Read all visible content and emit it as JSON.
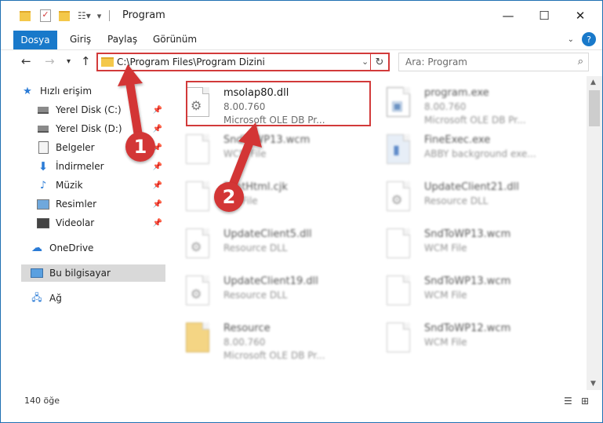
{
  "window": {
    "title": "Program"
  },
  "ribbon": {
    "tabs": [
      "Dosya",
      "Giriş",
      "Paylaş",
      "Görünüm"
    ],
    "help": "?"
  },
  "address": {
    "path": "C:\\Program Files\\Program Dizini"
  },
  "search": {
    "placeholder": "Ara: Program"
  },
  "sidebar": {
    "items": [
      {
        "label": "Hızlı erişim",
        "icon": "star-icon",
        "pinned": false
      },
      {
        "label": "Yerel Disk (C:)",
        "icon": "drive-icon",
        "pinned": true
      },
      {
        "label": "Yerel Disk (D:)",
        "icon": "drive-icon",
        "pinned": true
      },
      {
        "label": "Belgeler",
        "icon": "documents-icon",
        "pinned": true
      },
      {
        "label": "İndirmeler",
        "icon": "download-icon",
        "pinned": true
      },
      {
        "label": "Müzik",
        "icon": "music-icon",
        "pinned": true
      },
      {
        "label": "Resimler",
        "icon": "pictures-icon",
        "pinned": true
      },
      {
        "label": "Videolar",
        "icon": "videos-icon",
        "pinned": true
      },
      {
        "label": "OneDrive",
        "icon": "cloud-icon",
        "pinned": false
      },
      {
        "label": "Bu bilgisayar",
        "icon": "computer-icon",
        "pinned": false,
        "selected": true
      },
      {
        "label": "Ağ",
        "icon": "network-icon",
        "pinned": false
      }
    ]
  },
  "files": [
    {
      "name": "msolap80.dll",
      "line1": "8.00.760",
      "line2": "Microsoft OLE DB Pr...",
      "highlighted": true
    },
    {
      "name": "program.exe",
      "line1": "8.00.760",
      "line2": "Microsoft OLE DB Pr..."
    },
    {
      "name": "SndToWP13.wcm",
      "line1": "WCM File",
      "line2": ""
    },
    {
      "name": "FineExec.exe",
      "line1": "ABBY background exe...",
      "line2": ""
    },
    {
      "name": "FontHtml.cjk",
      "line1": "CJK File",
      "line2": ""
    },
    {
      "name": "UpdateClient21.dll",
      "line1": "Resource DLL",
      "line2": ""
    },
    {
      "name": "UpdateClient5.dll",
      "line1": "Resource DLL",
      "line2": ""
    },
    {
      "name": "SndToWP13.wcm",
      "line1": "WCM File",
      "line2": ""
    },
    {
      "name": "UpdateClient19.dll",
      "line1": "Resource DLL",
      "line2": ""
    },
    {
      "name": "SndToWP13.wcm",
      "line1": "WCM File",
      "line2": ""
    },
    {
      "name": "Resource",
      "line1": "8.00.760",
      "line2": "Microsoft OLE DB Pr..."
    },
    {
      "name": "SndToWP12.wcm",
      "line1": "WCM File",
      "line2": ""
    }
  ],
  "status": {
    "count": "140 öğe"
  },
  "annotations": {
    "step1": "1",
    "step2": "2"
  },
  "colors": {
    "accent": "#1979ca",
    "highlight": "#d23a3a",
    "folder": "#f4c84a"
  }
}
